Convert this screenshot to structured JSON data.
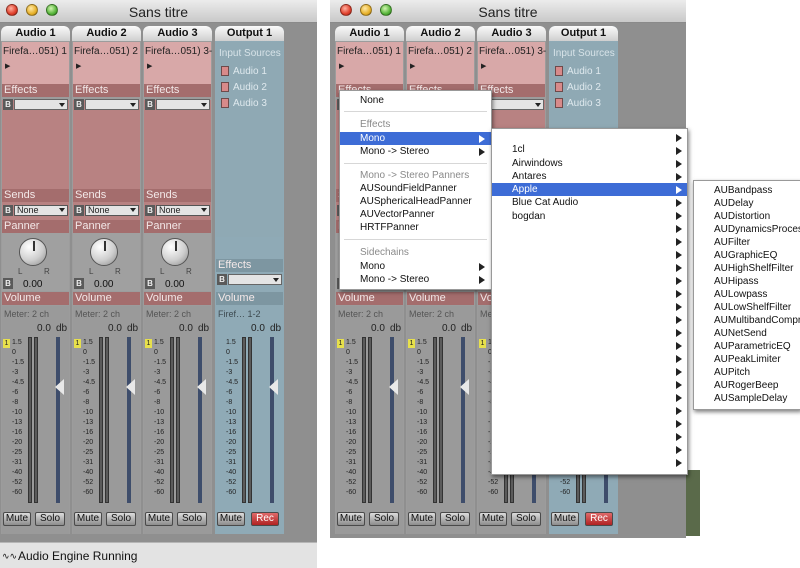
{
  "window_title": "Sans titre",
  "strips": [
    {
      "name": "Audio 1",
      "source": "Firefa…051) 1",
      "effects_label": "Effects",
      "sends_label": "Sends",
      "send_value": "None",
      "panner_label": "Panner",
      "pan_value": "0.00",
      "volume_label": "Volume",
      "meter_label": "Meter: 2 ch",
      "db_value": "0.0",
      "db_unit": "db",
      "mute": "Mute",
      "solo": "Solo"
    },
    {
      "name": "Audio 2",
      "source": "Firefa…051) 2",
      "effects_label": "Effects",
      "sends_label": "Sends",
      "send_value": "None",
      "panner_label": "Panner",
      "pan_value": "0.00",
      "volume_label": "Volume",
      "meter_label": "Meter: 2 ch",
      "db_value": "0.0",
      "db_unit": "db",
      "mute": "Mute",
      "solo": "Solo"
    },
    {
      "name": "Audio 3",
      "source": "Firefa…051) 3-4",
      "effects_label": "Effects",
      "sends_label": "Sends",
      "send_value": "None",
      "panner_label": "Panner",
      "pan_value": "0.00",
      "volume_label": "Volume",
      "meter_label": "Meter: 2 ch",
      "db_value": "0.0",
      "db_unit": "db",
      "mute": "Mute",
      "solo": "Solo"
    }
  ],
  "output": {
    "name": "Output 1",
    "input_sources_label": "Input Sources",
    "sources": [
      "Audio 1",
      "Audio 2",
      "Audio 3"
    ],
    "effects_label": "Effects",
    "volume_label": "Volume",
    "source_label": "Firef… 1-2",
    "db_value": "0.0",
    "db_unit": "db",
    "mute": "Mute",
    "rec": "Rec"
  },
  "meter_scale": [
    "1.5",
    "0",
    "-1.5",
    "-3",
    "-4.5",
    "-6",
    "-8",
    "-10",
    "-13",
    "-16",
    "-20",
    "-25",
    "-31",
    "-40",
    "-52",
    "-60"
  ],
  "clip_indicator": "1",
  "bypass_label": "B",
  "pan_left": "L",
  "pan_right": "R",
  "status_text": "Audio Engine Running",
  "context_menu": {
    "none": "None",
    "effects_header": "Effects",
    "mono": "Mono",
    "mono_stereo": "Mono -> Stereo",
    "panners_header": "Mono -> Stereo Panners",
    "panners": [
      "AUSoundFieldPanner",
      "AUSphericalHeadPanner",
      "AUVectorPanner",
      "HRTFPanner"
    ],
    "sidechains_header": "Sidechains",
    "sc_mono": "Mono",
    "sc_mono_stereo": "Mono -> Stereo"
  },
  "vendor_menu": [
    "1cl",
    "Airwindows",
    "Antares",
    "Apple",
    "Blue Cat Audio",
    "bogdan"
  ],
  "apple_menu": [
    "AUBandpass",
    "AUDelay",
    "AUDistortion",
    "AUDynamicsProces",
    "AUFilter",
    "AUGraphicEQ",
    "AUHighShelfFilter",
    "AUHipass",
    "AULowpass",
    "AULowShelfFilter",
    "AUMultibandCompr",
    "AUNetSend",
    "AUParametricEQ",
    "AUPeakLimiter",
    "AUPitch",
    "AURogerBeep",
    "AUSampleDelay"
  ],
  "colors": {
    "selection": "#3d6cd6",
    "strip_pink": "#c48a8a",
    "output_blue": "#8faab6",
    "rec_red": "#b02222"
  }
}
